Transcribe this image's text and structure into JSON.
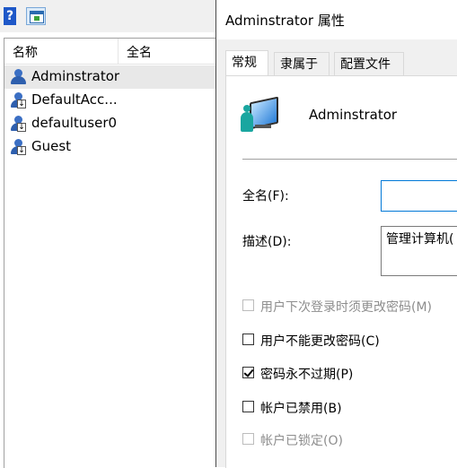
{
  "toolbar": {
    "help_icon_glyph": "?"
  },
  "list": {
    "columns": [
      "名称",
      "全名"
    ],
    "rows": [
      {
        "name": "Adminstrator",
        "selected": true
      },
      {
        "name": "DefaultAcc...",
        "selected": false
      },
      {
        "name": "defaultuser0",
        "selected": false
      },
      {
        "name": "Guest",
        "selected": false
      }
    ]
  },
  "dialog": {
    "title": "Adminstrator 属性",
    "tabs": [
      "常规",
      "隶属于",
      "配置文件"
    ],
    "active_tab": "常规",
    "account_name": "Adminstrator",
    "fullname_label": "全名(F):",
    "fullname_value": "",
    "description_label": "描述(D):",
    "description_value": "管理计算机(",
    "checkboxes": [
      {
        "label": "用户下次登录时须更改密码(M)",
        "checked": false,
        "enabled": false
      },
      {
        "label": "用户不能更改密码(C)",
        "checked": false,
        "enabled": true
      },
      {
        "label": "密码永不过期(P)",
        "checked": true,
        "enabled": true
      },
      {
        "label": "帐户已禁用(B)",
        "checked": false,
        "enabled": true
      },
      {
        "label": "帐户已锁定(O)",
        "checked": false,
        "enabled": false
      }
    ]
  },
  "colors": {
    "selection": "#e8e8e8",
    "focus_border": "#0078d7",
    "dialog_bg": "#f0f0f0"
  }
}
